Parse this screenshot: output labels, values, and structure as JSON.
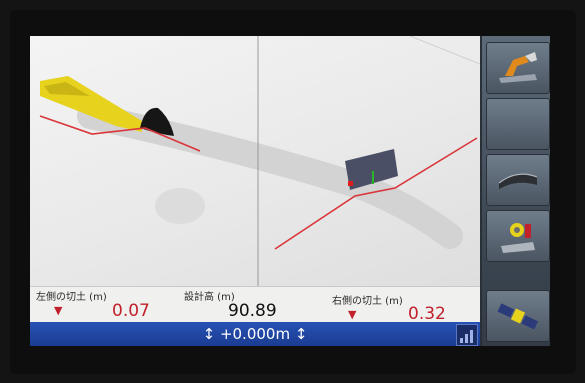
{
  "readouts": {
    "left_cut": {
      "label": "左側の切土 (m)",
      "value": "0.07"
    },
    "design_height": {
      "label": "設計高 (m)",
      "value": "90.89"
    },
    "right_cut": {
      "label": "右側の切土 (m)",
      "value": "0.32"
    }
  },
  "status_bar": {
    "offset_value": "+0.000m"
  },
  "icons": {
    "cut_indicator": "triangle-down-icon",
    "offset_arrow": "up-down-arrow-icon"
  },
  "colors": {
    "cut_value": "#c0212b",
    "status_bar": "#1f47a5",
    "design_line": "#d9353a",
    "blade": "#e7d21d"
  }
}
